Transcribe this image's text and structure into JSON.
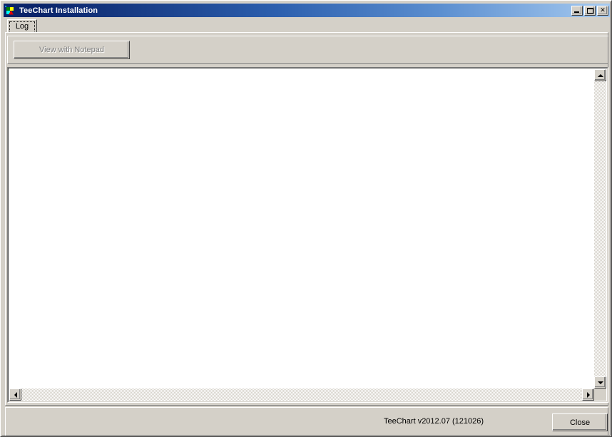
{
  "window": {
    "title": "TeeChart Installation",
    "icon": "teechart-app-icon",
    "controls": {
      "minimize_label": "_",
      "maximize_label": "□",
      "close_label": "✕"
    },
    "colors": {
      "titlebar_start": "#0a246a",
      "titlebar_end": "#a6caf0",
      "face": "#d4d0c8",
      "shadow": "#808080",
      "dark_shadow": "#404040",
      "highlight": "#ffffff",
      "client": "#ffffff",
      "disabled_text": "#808080"
    }
  },
  "tabs": [
    {
      "label": "Log",
      "selected": true
    }
  ],
  "toolbar": {
    "notepad_button_label": "View with Notepad",
    "notepad_button_enabled": false
  },
  "log": {
    "content": "",
    "vertical_scrollbar": {
      "up_arrow": "scroll-up-arrow",
      "down_arrow": "scroll-down-arrow"
    },
    "horizontal_scrollbar": {
      "left_arrow": "scroll-left-arrow",
      "right_arrow": "scroll-right-arrow"
    }
  },
  "footer": {
    "status_text": "TeeChart v2012.07 (121026)",
    "close_button_label": "Close"
  }
}
